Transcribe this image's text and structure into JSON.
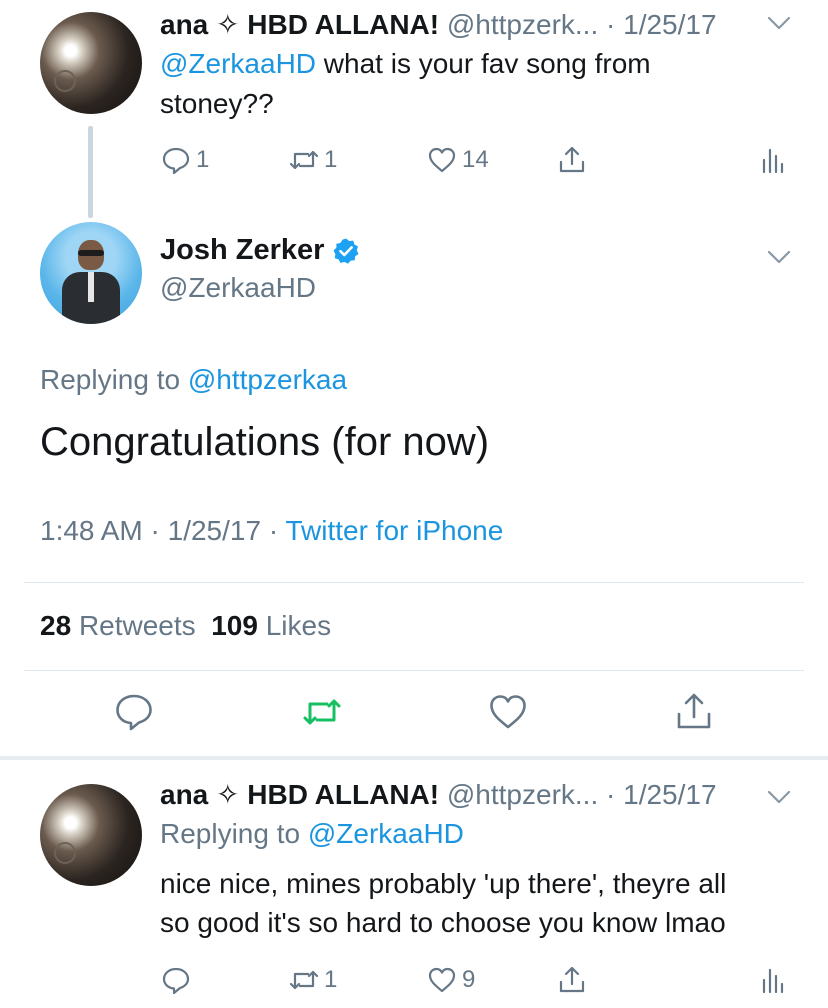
{
  "tweet1": {
    "display_name": "ana ✧ HBD ALLANA!",
    "handle": "@httpzerk...",
    "date": "· 1/25/17",
    "mention": "@ZerkaaHD",
    "text": " what is your fav song from",
    "text2": "stoney??",
    "reply_count": "1",
    "retweet_count": "1",
    "like_count": "14"
  },
  "focused": {
    "display_name": "Josh Zerker",
    "handle": "@ZerkaaHD",
    "replying_label": "Replying to",
    "replying_handle": "@httpzerkaa",
    "text": "Congratulations (for now)",
    "time": "1:48 AM",
    "date": "· 1/25/17 ·",
    "source": "Twitter for iPhone",
    "retweet_count": "28",
    "retweet_label": "Retweets",
    "like_count": "109",
    "like_label": "Likes"
  },
  "tweet3": {
    "display_name": "ana ✧ HBD ALLANA!",
    "handle": "@httpzerk...",
    "date": "· 1/25/17",
    "replying_label": "Replying to",
    "replying_handle": "@ZerkaaHD",
    "line1": "nice nice, mines probably 'up there', theyre all",
    "line2": "so good it's so hard to choose you know lmao",
    "retweet_count": "1",
    "like_count": "9"
  },
  "colors": {
    "link": "#1b95e0",
    "muted": "#657786",
    "retweet_green": "#17bf63",
    "verified_blue": "#1da1f2"
  },
  "icons": [
    "reply-icon",
    "retweet-icon",
    "like-icon",
    "share-icon",
    "analytics-icon",
    "chevron-down-icon",
    "verified-badge-icon"
  ]
}
